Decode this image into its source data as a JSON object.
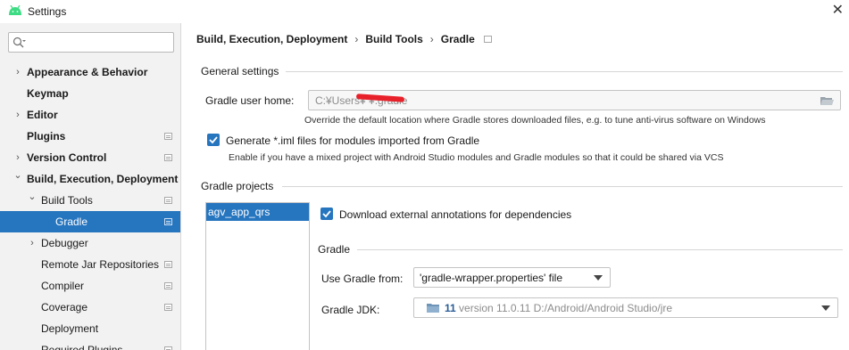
{
  "window": {
    "title": "Settings",
    "close_glyph": "✕",
    "icon": "android-icon",
    "icon_color": "#3ddc84"
  },
  "sidebar": {
    "search_placeholder": "",
    "items": [
      {
        "label": "Appearance & Behavior",
        "chevron": "›",
        "bold": true
      },
      {
        "label": "Keymap",
        "chevron": "",
        "bold": true
      },
      {
        "label": "Editor",
        "chevron": "›",
        "bold": true
      },
      {
        "label": "Plugins",
        "chevron": "",
        "bold": true,
        "project_icon": true
      },
      {
        "label": "Version Control",
        "chevron": "›",
        "bold": true,
        "project_icon": true
      },
      {
        "label": "Build, Execution, Deployment",
        "chevron": "⌄",
        "bold": true
      },
      {
        "label": "Build Tools",
        "chevron": "⌄",
        "bold": false,
        "project_icon": true
      },
      {
        "label": "Gradle",
        "chevron": "",
        "bold": false,
        "project_icon": true,
        "selected": true
      },
      {
        "label": "Debugger",
        "chevron": "›",
        "bold": false
      },
      {
        "label": "Remote Jar Repositories",
        "chevron": "",
        "bold": false,
        "project_icon": true
      },
      {
        "label": "Compiler",
        "chevron": "",
        "bold": false,
        "project_icon": true
      },
      {
        "label": "Coverage",
        "chevron": "",
        "bold": false,
        "project_icon": true
      },
      {
        "label": "Deployment",
        "chevron": "",
        "bold": false
      },
      {
        "label": "Required Plugins",
        "chevron": "",
        "bold": false,
        "project_icon": true
      }
    ]
  },
  "breadcrumb": {
    "parts": [
      "Build, Execution, Deployment",
      "Build Tools",
      "Gradle"
    ],
    "separator": "›"
  },
  "general": {
    "title": "General settings",
    "user_home_label": "Gradle user home:",
    "user_home_value": "C:¥Users¥                ¥.gradle",
    "user_home_hint": "Override the default location where Gradle stores downloaded files, e.g. to tune anti-virus software on Windows",
    "iml_checkbox_label": "Generate *.iml files for modules imported from Gradle",
    "iml_checked": true,
    "iml_hint": "Enable if you have a mixed project with Android Studio modules and Gradle modules so that it could be shared via VCS"
  },
  "projects": {
    "title": "Gradle projects",
    "list": [
      "agv_app_qrs"
    ],
    "download_annotations_label": "Download external annotations for dependencies",
    "download_annotations_checked": true,
    "gradle_section_title": "Gradle",
    "use_gradle_from_label": "Use Gradle from:",
    "use_gradle_from_value": "'gradle-wrapper.properties' file",
    "jdk_label": "Gradle JDK:",
    "jdk_version": "11",
    "jdk_detail": "version 11.0.11 D:/Android/Android Studio/jre"
  },
  "colors": {
    "accent": "#2675bf",
    "sidebar_bg": "#f2f2f2"
  }
}
